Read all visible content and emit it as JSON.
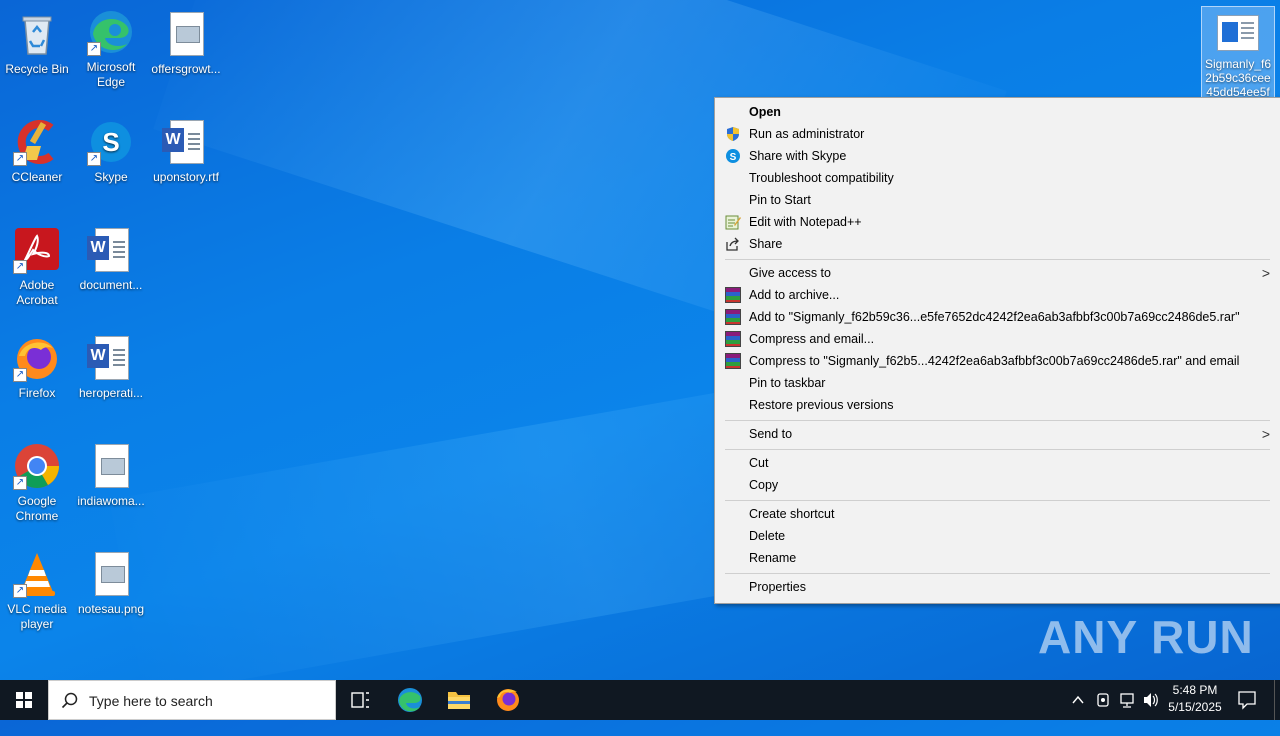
{
  "desktop": {
    "icons": [
      {
        "label": "Recycle Bin"
      },
      {
        "label": "Microsoft Edge"
      },
      {
        "label": "offersgrowt..."
      },
      {
        "label": "CCleaner"
      },
      {
        "label": "Skype"
      },
      {
        "label": "uponstory.rtf"
      },
      {
        "label": "Adobe Acrobat"
      },
      {
        "label": "document..."
      },
      {
        "label": "Firefox"
      },
      {
        "label": "heroperati..."
      },
      {
        "label": "Google Chrome"
      },
      {
        "label": "indiawoma..."
      },
      {
        "label": "VLC media player"
      },
      {
        "label": "notesau.png"
      }
    ],
    "selected_file": {
      "label": "Sigmanly_f62b59c36cee45dd54ee5fe76"
    }
  },
  "context_menu": {
    "items": [
      {
        "label": "Open",
        "icon": "none"
      },
      {
        "label": "Run as administrator",
        "icon": "uac-shield-icon"
      },
      {
        "label": "Share with Skype",
        "icon": "skype-icon"
      },
      {
        "label": "Troubleshoot compatibility",
        "icon": "none"
      },
      {
        "label": "Pin to Start",
        "icon": "none"
      },
      {
        "label": "Edit with Notepad++",
        "icon": "notepadpp-icon"
      },
      {
        "label": "Share",
        "icon": "share-icon"
      },
      {
        "label": "Give access to",
        "icon": "none"
      },
      {
        "label": "Add to archive...",
        "icon": "winrar-icon"
      },
      {
        "label": "Add to \"Sigmanly_f62b59c36...e5fe7652dc4242f2ea6ab3afbbf3c00b7a69cc2486de5.rar\"",
        "icon": "winrar-icon"
      },
      {
        "label": "Compress and email...",
        "icon": "winrar-icon"
      },
      {
        "label": "Compress to \"Sigmanly_f62b5...4242f2ea6ab3afbbf3c00b7a69cc2486de5.rar\" and email",
        "icon": "winrar-icon"
      },
      {
        "label": "Pin to taskbar",
        "icon": "none"
      },
      {
        "label": "Restore previous versions",
        "icon": "none"
      },
      {
        "label": "Send to",
        "icon": "none"
      },
      {
        "label": "Cut",
        "icon": "none"
      },
      {
        "label": "Copy",
        "icon": "none"
      },
      {
        "label": "Create shortcut",
        "icon": "none"
      },
      {
        "label": "Delete",
        "icon": "none"
      },
      {
        "label": "Rename",
        "icon": "none"
      },
      {
        "label": "Properties",
        "icon": "none"
      }
    ]
  },
  "watermark": {
    "text": "ANY RUN"
  },
  "taskbar": {
    "search_placeholder": "Type here to search",
    "time": "5:48 PM",
    "date": "5/15/2025"
  },
  "colors": {
    "desktop_bg": "#0a7ee6",
    "taskbar_bg": "#101822",
    "menu_bg": "#f2f2f2"
  }
}
